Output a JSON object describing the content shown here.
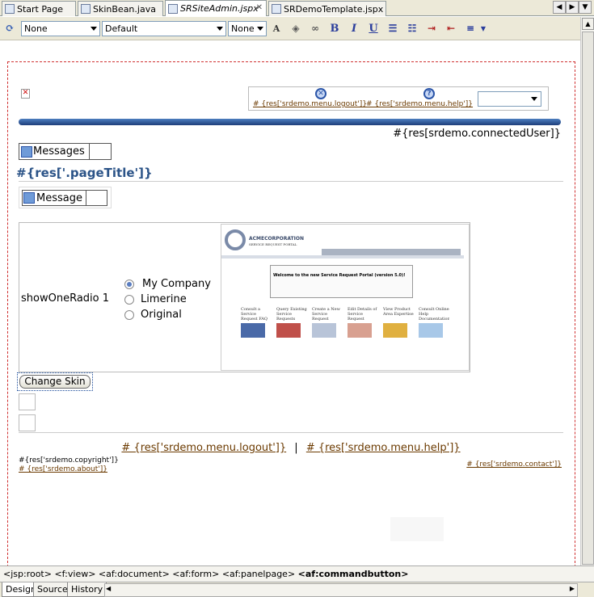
{
  "tabs": [
    {
      "label": "Start Page",
      "italic": false
    },
    {
      "label": "SkinBean.java",
      "italic": false
    },
    {
      "label": "SRSiteAdmin.jspx",
      "italic": true
    },
    {
      "label": "SRDemoTemplate.jspx",
      "italic": false
    }
  ],
  "toolbar": {
    "style_select": "None",
    "class_select": "Default",
    "size_select": "None",
    "bold": "B",
    "italic": "I",
    "underline": "U"
  },
  "page": {
    "logout_link": "# {res['srdemo.menu.logout']}",
    "help_link": "# {res['srdemo.menu.help']}",
    "connected_user": "#{res[srdemo.connectedUser]}",
    "messages_label": "Messages",
    "page_title": "#{res['.pageTitle']}",
    "message_label": "Message",
    "radio_label": "showOneRadio 1",
    "radio_options": [
      "My Company",
      "Limerine",
      "Original"
    ],
    "radio_selected": "My Company",
    "change_skin": "Change Skin",
    "footer_logout": "# {res['srdemo.menu.logout']}",
    "footer_separator": "|",
    "footer_help": "# {res['srdemo.menu.help']}",
    "copyright": "#{res['srdemo.copyright']}",
    "about": "# {res['srdemo.about']}",
    "contact": "# {res['srdemo.contact']}"
  },
  "preview": {
    "brand": "ACMECORPORATION",
    "subtitle": "SERVICE REQUEST PORTAL",
    "welcome": "Welcome to the new Service Request Portal (version 5.0)!",
    "cards": [
      "Consult a Service Request FAQ",
      "Query Existing Service Requests",
      "Create a New Service Request",
      "Edit Details of Service Request",
      "View Product Area Expertise",
      "Consult Online Help Documentation"
    ]
  },
  "breadcrumb": {
    "items": [
      "<jsp:root>",
      "<f:view>",
      "<af:document>",
      "<af:form>",
      "<af:panelpage>"
    ],
    "current": "<af:commandbutton>"
  },
  "bottom_tabs": [
    "Design",
    "Source",
    "History"
  ]
}
